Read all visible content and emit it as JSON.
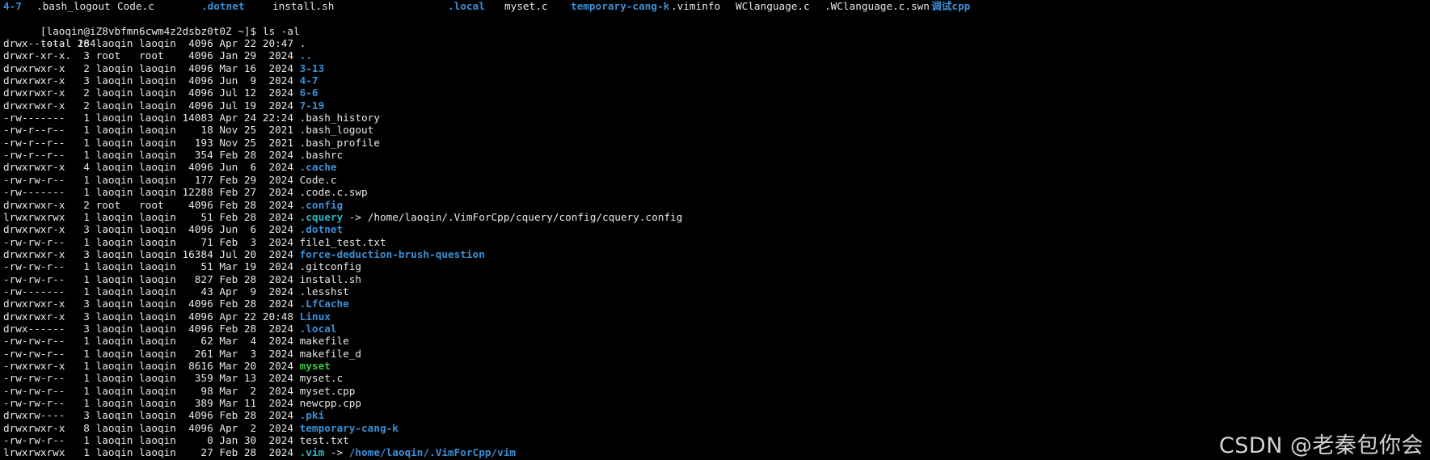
{
  "colors": {
    "background": "#000000",
    "text": "#e6e6e6",
    "directory": "#3a8fd6",
    "executable": "#37c837",
    "symlink": "#2ab5c6"
  },
  "top_listing": [
    {
      "name": "4-7",
      "kind": "dir"
    },
    {
      "name": ".bash_logout",
      "kind": "file"
    },
    {
      "name": "Code.c",
      "kind": "file"
    },
    {
      "name": ".dotnet",
      "kind": "dir"
    },
    {
      "name": "install.sh",
      "kind": "file"
    },
    {
      "name": ".local",
      "kind": "dir"
    },
    {
      "name": "myset.c",
      "kind": "file"
    },
    {
      "name": "temporary-cang-k",
      "kind": "dir"
    },
    {
      "name": ".viminfo",
      "kind": "file"
    },
    {
      "name": "WClanguage.c",
      "kind": "file"
    },
    {
      "name": ".WClanguage.c.swn",
      "kind": "file"
    },
    {
      "name": "调试cpp",
      "kind": "dir"
    }
  ],
  "prompt": "[laoqin@iZ8vbfmn6cwm4z2dsbz0t0Z ~]$ ls -al",
  "total": "total 264",
  "entries": [
    {
      "meta": "drwx------  18 laoqin laoqin  4096 Apr 22 20:47 ",
      "name": ".",
      "kind": "file",
      "target": "",
      "target_kind": ""
    },
    {
      "meta": "drwxr-xr-x.  3 root   root    4096 Jan 29  2024 ",
      "name": "..",
      "kind": "dir",
      "target": "",
      "target_kind": ""
    },
    {
      "meta": "drwxrwxr-x   2 laoqin laoqin  4096 Mar 16  2024 ",
      "name": "3-13",
      "kind": "dir",
      "target": "",
      "target_kind": ""
    },
    {
      "meta": "drwxrwxr-x   3 laoqin laoqin  4096 Jun  9  2024 ",
      "name": "4-7",
      "kind": "dir",
      "target": "",
      "target_kind": ""
    },
    {
      "meta": "drwxrwxr-x   2 laoqin laoqin  4096 Jul 12  2024 ",
      "name": "6-6",
      "kind": "dir",
      "target": "",
      "target_kind": ""
    },
    {
      "meta": "drwxrwxr-x   2 laoqin laoqin  4096 Jul 19  2024 ",
      "name": "7-19",
      "kind": "dir",
      "target": "",
      "target_kind": ""
    },
    {
      "meta": "-rw-------   1 laoqin laoqin 14083 Apr 24 22:24 ",
      "name": ".bash_history",
      "kind": "file",
      "target": "",
      "target_kind": ""
    },
    {
      "meta": "-rw-r--r--   1 laoqin laoqin    18 Nov 25  2021 ",
      "name": ".bash_logout",
      "kind": "file",
      "target": "",
      "target_kind": ""
    },
    {
      "meta": "-rw-r--r--   1 laoqin laoqin   193 Nov 25  2021 ",
      "name": ".bash_profile",
      "kind": "file",
      "target": "",
      "target_kind": ""
    },
    {
      "meta": "-rw-r--r--   1 laoqin laoqin   354 Feb 28  2024 ",
      "name": ".bashrc",
      "kind": "file",
      "target": "",
      "target_kind": ""
    },
    {
      "meta": "drwxrwxr-x   4 laoqin laoqin  4096 Jun  6  2024 ",
      "name": ".cache",
      "kind": "dir",
      "target": "",
      "target_kind": ""
    },
    {
      "meta": "-rw-rw-r--   1 laoqin laoqin   177 Feb 29  2024 ",
      "name": "Code.c",
      "kind": "file",
      "target": "",
      "target_kind": ""
    },
    {
      "meta": "-rw-------   1 laoqin laoqin 12288 Feb 27  2024 ",
      "name": ".code.c.swp",
      "kind": "file",
      "target": "",
      "target_kind": ""
    },
    {
      "meta": "drwxrwxr-x   2 root   root    4096 Feb 28  2024 ",
      "name": ".config",
      "kind": "dir",
      "target": "",
      "target_kind": ""
    },
    {
      "meta": "lrwxrwxrwx   1 laoqin laoqin    51 Feb 28  2024 ",
      "name": ".cquery",
      "kind": "link",
      "target": "/home/laoqin/.VimForCpp/cquery/config/cquery.config",
      "target_kind": "file"
    },
    {
      "meta": "drwxrwxr-x   3 laoqin laoqin  4096 Jun  6  2024 ",
      "name": ".dotnet",
      "kind": "dir",
      "target": "",
      "target_kind": ""
    },
    {
      "meta": "-rw-rw-r--   1 laoqin laoqin    71 Feb  3  2024 ",
      "name": "file1_test.txt",
      "kind": "file",
      "target": "",
      "target_kind": ""
    },
    {
      "meta": "drwxrwxr-x   3 laoqin laoqin 16384 Jul 20  2024 ",
      "name": "force-deduction-brush-question",
      "kind": "dir",
      "target": "",
      "target_kind": ""
    },
    {
      "meta": "-rw-rw-r--   1 laoqin laoqin    51 Mar 19  2024 ",
      "name": ".gitconfig",
      "kind": "file",
      "target": "",
      "target_kind": ""
    },
    {
      "meta": "-rw-rw-r--   1 laoqin laoqin   827 Feb 28  2024 ",
      "name": "install.sh",
      "kind": "file",
      "target": "",
      "target_kind": ""
    },
    {
      "meta": "-rw-------   1 laoqin laoqin    43 Apr  9  2024 ",
      "name": ".lesshst",
      "kind": "file",
      "target": "",
      "target_kind": ""
    },
    {
      "meta": "drwxrwxr-x   3 laoqin laoqin  4096 Feb 28  2024 ",
      "name": ".LfCache",
      "kind": "dir",
      "target": "",
      "target_kind": ""
    },
    {
      "meta": "drwxrwxr-x   3 laoqin laoqin  4096 Apr 22 20:48 ",
      "name": "Linux",
      "kind": "dir",
      "target": "",
      "target_kind": ""
    },
    {
      "meta": "drwx------   3 laoqin laoqin  4096 Feb 28  2024 ",
      "name": ".local",
      "kind": "dir",
      "target": "",
      "target_kind": ""
    },
    {
      "meta": "-rw-rw-r--   1 laoqin laoqin    62 Mar  4  2024 ",
      "name": "makefile",
      "kind": "file",
      "target": "",
      "target_kind": ""
    },
    {
      "meta": "-rw-rw-r--   1 laoqin laoqin   261 Mar  3  2024 ",
      "name": "makefile_d",
      "kind": "file",
      "target": "",
      "target_kind": ""
    },
    {
      "meta": "-rwxrwxr-x   1 laoqin laoqin  8616 Mar 20  2024 ",
      "name": "myset",
      "kind": "exe",
      "target": "",
      "target_kind": ""
    },
    {
      "meta": "-rw-rw-r--   1 laoqin laoqin   359 Mar 13  2024 ",
      "name": "myset.c",
      "kind": "file",
      "target": "",
      "target_kind": ""
    },
    {
      "meta": "-rw-rw-r--   1 laoqin laoqin    98 Mar  2  2024 ",
      "name": "myset.cpp",
      "kind": "file",
      "target": "",
      "target_kind": ""
    },
    {
      "meta": "-rw-rw-r--   1 laoqin laoqin   389 Mar 11  2024 ",
      "name": "newcpp.cpp",
      "kind": "file",
      "target": "",
      "target_kind": ""
    },
    {
      "meta": "drwxrw----   3 laoqin laoqin  4096 Feb 28  2024 ",
      "name": ".pki",
      "kind": "dir",
      "target": "",
      "target_kind": ""
    },
    {
      "meta": "drwxrwxr-x   8 laoqin laoqin  4096 Apr  2  2024 ",
      "name": "temporary-cang-k",
      "kind": "dir",
      "target": "",
      "target_kind": ""
    },
    {
      "meta": "-rw-rw-r--   1 laoqin laoqin     0 Jan 30  2024 ",
      "name": "test.txt",
      "kind": "file",
      "target": "",
      "target_kind": ""
    },
    {
      "meta": "lrwxrwxrwx   1 laoqin laoqin    27 Feb 28  2024 ",
      "name": ".vim",
      "kind": "link",
      "target": "/home/laoqin/.VimForCpp/vim",
      "target_kind": "dir"
    }
  ],
  "link_arrow": " -> ",
  "watermark": "CSDN @老秦包你会"
}
